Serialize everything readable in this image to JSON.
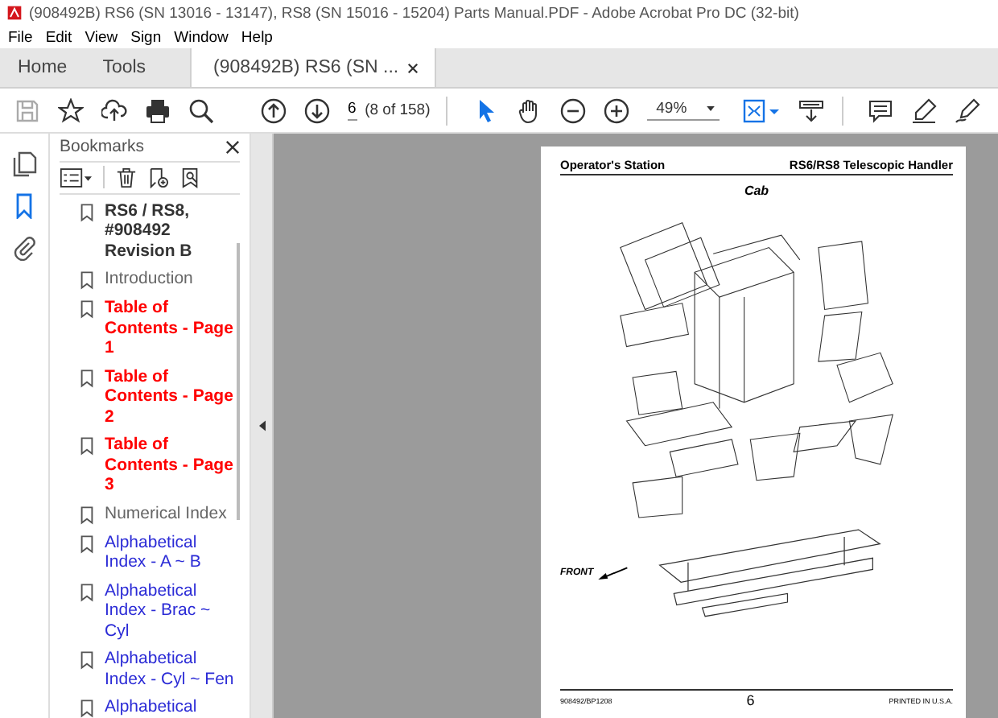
{
  "window": {
    "title": "(908492B) RS6 (SN 13016 - 13147), RS8 (SN 15016 - 15204) Parts Manual.PDF - Adobe Acrobat Pro DC (32-bit)"
  },
  "menu": [
    "File",
    "Edit",
    "View",
    "Sign",
    "Window",
    "Help"
  ],
  "tabs": [
    {
      "label": "Home",
      "selected": false,
      "closable": false
    },
    {
      "label": "Tools",
      "selected": false,
      "closable": false
    },
    {
      "label": "(908492B) RS6 (SN ...",
      "selected": true,
      "closable": true
    }
  ],
  "toolbar": {
    "page": "6",
    "page_count": "(8 of 158)",
    "zoom": "49%"
  },
  "side_icons": [
    {
      "kind": "pages",
      "selected": false
    },
    {
      "kind": "bookmarks",
      "selected": true
    },
    {
      "kind": "attachments",
      "selected": false
    }
  ],
  "bookmarks": {
    "title": "Bookmarks",
    "items": [
      {
        "label": "RS6 / RS8, #908492 Revision B",
        "color": "#333333",
        "bold": true
      },
      {
        "label": "Introduction",
        "color": "#666666",
        "bold": false
      },
      {
        "label": "Table of Contents - Page 1",
        "color": "#ff0000",
        "bold": true
      },
      {
        "label": "Table of Contents - Page 2",
        "color": "#ff0000",
        "bold": true
      },
      {
        "label": "Table of Contents - Page 3",
        "color": "#ff0000",
        "bold": true
      },
      {
        "label": "Numerical Index",
        "color": "#666666",
        "bold": false
      },
      {
        "label": "Alphabetical Index - A ~ B",
        "color": "#2b2bd6",
        "bold": false
      },
      {
        "label": "Alphabetical Index - Brac ~ Cyl",
        "color": "#2b2bd6",
        "bold": false
      },
      {
        "label": "Alphabetical Index - Cyl ~ Fen",
        "color": "#2b2bd6",
        "bold": false
      },
      {
        "label": "Alphabetical",
        "color": "#2b2bd6",
        "bold": false
      }
    ]
  },
  "page": {
    "section": "Operator's Station",
    "product": "RS6/RS8 Telescopic Handler",
    "figure_title": "Cab",
    "front_label": "FRONT",
    "footer_left": "908492/BP1208",
    "page_number": "6",
    "footer_right": "PRINTED IN U.S.A."
  }
}
